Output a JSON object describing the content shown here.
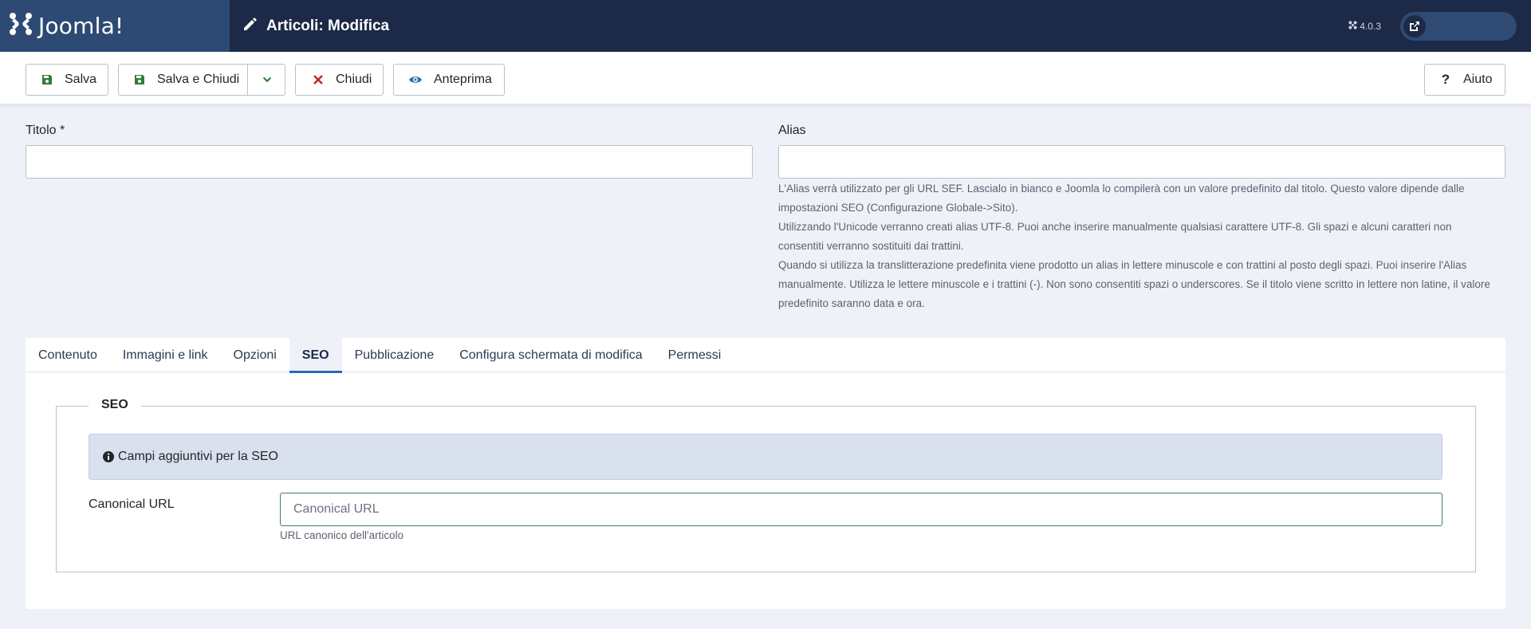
{
  "header": {
    "brand": "Joomla!",
    "page_title": "Articoli: Modifica",
    "version": "4.0.3",
    "colors": {
      "header_bg": "#1c2a47",
      "brand_bg": "#2c4a73"
    }
  },
  "toolbar": {
    "save_label": "Salva",
    "save_close_label": "Salva e Chiudi",
    "close_label": "Chiudi",
    "preview_label": "Anteprima",
    "help_label": "Aiuto"
  },
  "form": {
    "title_label": "Titolo *",
    "title_value": "",
    "alias_label": "Alias",
    "alias_value": "",
    "alias_help": [
      "L'Alias verrà utilizzato per gli URL SEF. Lascialo in bianco e Joomla lo compilerà con un valore predefinito dal titolo. Questo valore dipende dalle impostazioni SEO (Configurazione Globale->Sito).",
      "Utilizzando l'Unicode verranno creati alias UTF-8. Puoi anche inserire manualmente qualsiasi carattere UTF-8. Gli spazi e alcuni caratteri non consentiti verranno sostituiti dai trattini.",
      "Quando si utilizza la translitterazione predefinita viene prodotto un alias in lettere minuscole e con trattini al posto degli spazi. Puoi inserire l'Alias manualmente. Utilizza le lettere minuscole e i trattini (-). Non sono consentiti spazi o underscores. Se il titolo viene scritto in lettere non latine, il valore predefinito saranno data e ora."
    ]
  },
  "tabs": [
    {
      "label": "Contenuto",
      "active": false
    },
    {
      "label": "Immagini e link",
      "active": false
    },
    {
      "label": "Opzioni",
      "active": false
    },
    {
      "label": "SEO",
      "active": true
    },
    {
      "label": "Pubblicazione",
      "active": false
    },
    {
      "label": "Configura schermata di modifica",
      "active": false
    },
    {
      "label": "Permessi",
      "active": false
    }
  ],
  "seo": {
    "legend": "SEO",
    "alert": "Campi aggiuntivi per la SEO",
    "canonical_label": "Canonical URL",
    "canonical_placeholder": "Canonical URL",
    "canonical_value": "",
    "canonical_help": "URL canonico dell'articolo"
  }
}
